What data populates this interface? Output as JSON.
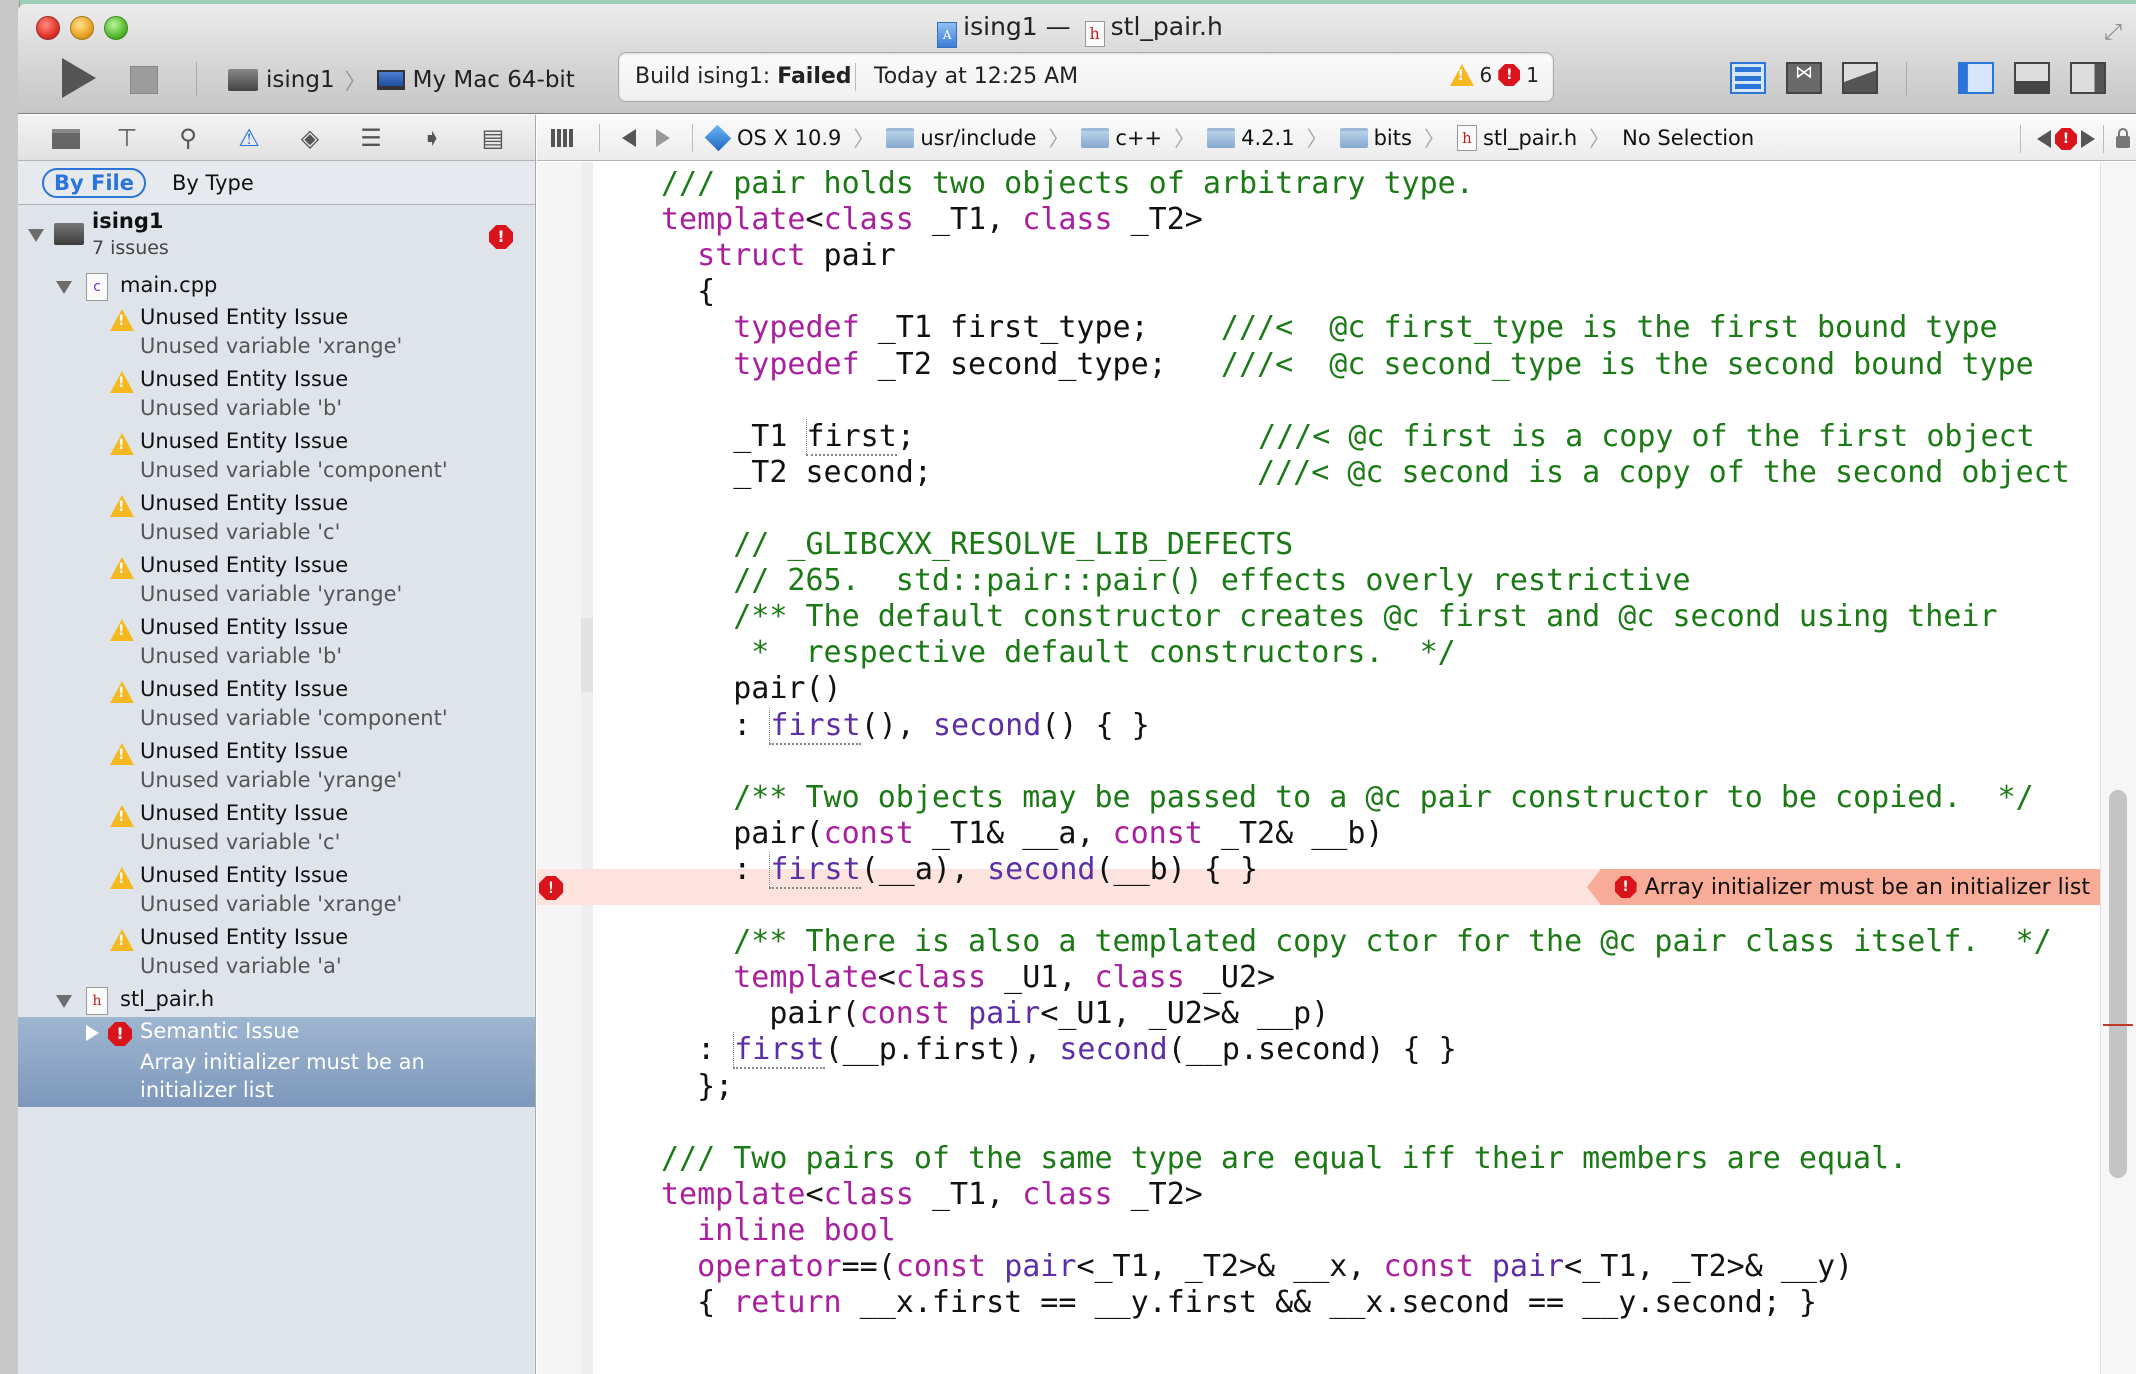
{
  "window": {
    "title_project": "ising1",
    "title_separator": "—",
    "title_file": "stl_pair.h"
  },
  "toolbar": {
    "run_label": "Run",
    "stop_label": "Stop",
    "scheme": "ising1",
    "destination": "My Mac 64-bit",
    "activity": {
      "status_prefix": "Build ising1: ",
      "status_result": "Failed",
      "time": "Today at 12:25 AM",
      "warning_count": "6",
      "error_count": "1"
    }
  },
  "navigator": {
    "tabs": [
      "project-navigator",
      "symbol-navigator",
      "find-navigator",
      "issue-navigator",
      "test-navigator",
      "debug-navigator",
      "breakpoint-navigator",
      "log-navigator"
    ],
    "selected_tab": "issue-navigator",
    "scope": {
      "by_file": "By File",
      "by_type": "By Type",
      "selected": "By File"
    },
    "project": {
      "name": "ising1",
      "issue_count": "7 issues"
    },
    "files": [
      {
        "name": "main.cpp",
        "issues": [
          {
            "type": "warning",
            "title": "Unused Entity Issue",
            "message": "Unused variable 'xrange'"
          },
          {
            "type": "warning",
            "title": "Unused Entity Issue",
            "message": "Unused variable 'b'"
          },
          {
            "type": "warning",
            "title": "Unused Entity Issue",
            "message": "Unused variable 'component'"
          },
          {
            "type": "warning",
            "title": "Unused Entity Issue",
            "message": "Unused variable 'c'"
          },
          {
            "type": "warning",
            "title": "Unused Entity Issue",
            "message": "Unused variable 'yrange'"
          },
          {
            "type": "warning",
            "title": "Unused Entity Issue",
            "message": "Unused variable 'b'"
          },
          {
            "type": "warning",
            "title": "Unused Entity Issue",
            "message": "Unused variable 'component'"
          },
          {
            "type": "warning",
            "title": "Unused Entity Issue",
            "message": "Unused variable 'yrange'"
          },
          {
            "type": "warning",
            "title": "Unused Entity Issue",
            "message": "Unused variable 'c'"
          },
          {
            "type": "warning",
            "title": "Unused Entity Issue",
            "message": "Unused variable 'xrange'"
          },
          {
            "type": "warning",
            "title": "Unused Entity Issue",
            "message": "Unused variable 'a'"
          }
        ]
      },
      {
        "name": "stl_pair.h",
        "issues": [
          {
            "type": "error",
            "title": "Semantic Issue",
            "message": "Array initializer must be an initializer list",
            "selected": true
          }
        ]
      }
    ]
  },
  "jumpbar": {
    "crumbs": [
      "OS X 10.9",
      "usr/include",
      "c++",
      "4.2.1",
      "bits",
      "stl_pair.h",
      "No Selection"
    ]
  },
  "editor": {
    "error_message": "Array initializer must be an initializer list",
    "lines": [
      [
        {
          "t": "/// pair holds two objects of arbitrary type.",
          "c": "c"
        }
      ],
      [
        {
          "t": "template",
          "c": "k"
        },
        {
          "t": "<"
        },
        {
          "t": "class",
          "c": "k"
        },
        {
          "t": " _T1, "
        },
        {
          "t": "class",
          "c": "k"
        },
        {
          "t": " _T2>"
        }
      ],
      [
        {
          "t": "  "
        },
        {
          "t": "struct",
          "c": "k"
        },
        {
          "t": " pair"
        }
      ],
      [
        {
          "t": "  {"
        }
      ],
      [
        {
          "t": "    "
        },
        {
          "t": "typedef",
          "c": "k"
        },
        {
          "t": " _T1 first_type;    "
        },
        {
          "t": "///<  @c first_type is the first bound type",
          "c": "c"
        }
      ],
      [
        {
          "t": "    "
        },
        {
          "t": "typedef",
          "c": "k"
        },
        {
          "t": " _T2 second_type;   "
        },
        {
          "t": "///<  @c second_type is the second bound type",
          "c": "c"
        }
      ],
      [],
      [
        {
          "t": "    _T1 "
        },
        {
          "t": "first",
          "d": 1
        },
        {
          "t": ";                   "
        },
        {
          "t": "///< @c first is a copy of the first object",
          "c": "c"
        }
      ],
      [
        {
          "t": "    _T2 second;                  "
        },
        {
          "t": "///< @c second is a copy of the second object",
          "c": "c"
        }
      ],
      [],
      [
        {
          "t": "    "
        },
        {
          "t": "// _GLIBCXX_RESOLVE_LIB_DEFECTS",
          "c": "c"
        }
      ],
      [
        {
          "t": "    "
        },
        {
          "t": "// 265.  std::pair::pair() effects overly restrictive",
          "c": "c"
        }
      ],
      [
        {
          "t": "    "
        },
        {
          "t": "/** The default constructor creates @c first and @c second using their",
          "c": "c"
        }
      ],
      [
        {
          "t": "    "
        },
        {
          "t": " *  respective default constructors.  */",
          "c": "c"
        }
      ],
      [
        {
          "t": "    pair()"
        }
      ],
      [
        {
          "t": "    : "
        },
        {
          "t": "first",
          "c": "m",
          "d": 1
        },
        {
          "t": "(), "
        },
        {
          "t": "second",
          "c": "m"
        },
        {
          "t": "() { }"
        }
      ],
      [],
      [
        {
          "t": "    "
        },
        {
          "t": "/** Two objects may be passed to a @c pair constructor to be copied.  */",
          "c": "c"
        }
      ],
      [
        {
          "t": "    pair("
        },
        {
          "t": "const",
          "c": "k"
        },
        {
          "t": " _T1& __a, "
        },
        {
          "t": "const",
          "c": "k"
        },
        {
          "t": " _T2& __b)"
        }
      ],
      [
        {
          "t": "    : "
        },
        {
          "t": "first",
          "c": "m",
          "d": 1
        },
        {
          "t": "(__a), "
        },
        {
          "t": "second",
          "c": "m"
        },
        {
          "t": "(__b) { }"
        }
      ],
      [],
      [
        {
          "t": "    "
        },
        {
          "t": "/** There is also a templated copy ctor for the @c pair class itself.  */",
          "c": "c"
        }
      ],
      [
        {
          "t": "    "
        },
        {
          "t": "template",
          "c": "k"
        },
        {
          "t": "<"
        },
        {
          "t": "class",
          "c": "k"
        },
        {
          "t": " _U1, "
        },
        {
          "t": "class",
          "c": "k"
        },
        {
          "t": " _U2>"
        }
      ],
      [
        {
          "t": "      pair("
        },
        {
          "t": "const",
          "c": "k"
        },
        {
          "t": " "
        },
        {
          "t": "pair",
          "c": "m"
        },
        {
          "t": "<_U1, _U2>& __p)"
        }
      ],
      [
        {
          "t": "  : "
        },
        {
          "t": "first",
          "c": "m",
          "d": 1
        },
        {
          "t": "(__p.first), "
        },
        {
          "t": "second",
          "c": "m"
        },
        {
          "t": "(__p.second) { }"
        }
      ],
      [
        {
          "t": "  };"
        }
      ],
      [],
      [
        {
          "t": "/// Two pairs of the same type are equal iff their members are equal.",
          "c": "c"
        }
      ],
      [
        {
          "t": "template",
          "c": "k"
        },
        {
          "t": "<"
        },
        {
          "t": "class",
          "c": "k"
        },
        {
          "t": " _T1, "
        },
        {
          "t": "class",
          "c": "k"
        },
        {
          "t": " _T2>"
        }
      ],
      [
        {
          "t": "  "
        },
        {
          "t": "inline",
          "c": "k"
        },
        {
          "t": " "
        },
        {
          "t": "bool",
          "c": "k"
        }
      ],
      [
        {
          "t": "  "
        },
        {
          "t": "operator",
          "c": "k"
        },
        {
          "t": "==("
        },
        {
          "t": "const",
          "c": "k"
        },
        {
          "t": " "
        },
        {
          "t": "pair",
          "c": "m"
        },
        {
          "t": "<_T1, _T2>& __x, "
        },
        {
          "t": "const",
          "c": "k"
        },
        {
          "t": " "
        },
        {
          "t": "pair",
          "c": "m"
        },
        {
          "t": "<_T1, _T2>& __y)"
        }
      ],
      [
        {
          "t": "  { "
        },
        {
          "t": "return",
          "c": "k"
        },
        {
          "t": " __x.first == __y.first && __x.second == __y.second; }"
        }
      ]
    ],
    "error_line_index": 19
  }
}
